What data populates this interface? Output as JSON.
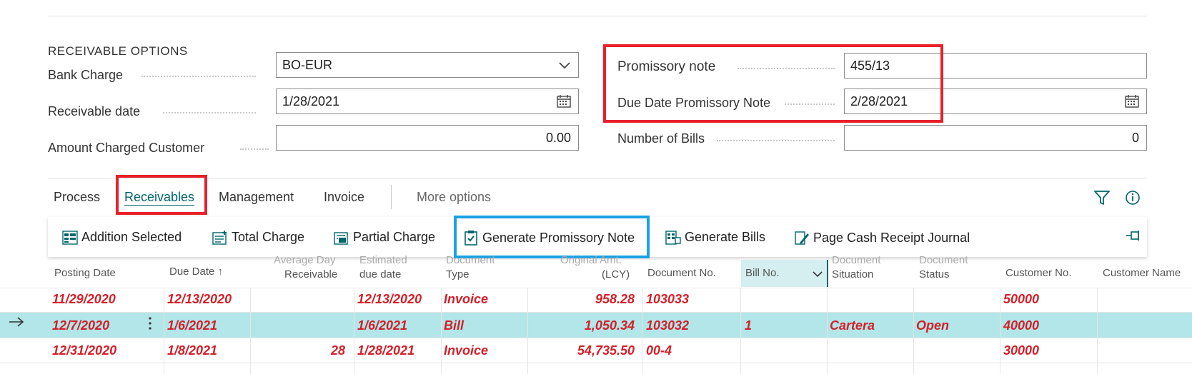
{
  "options": {
    "section_title": "RECEIVABLE OPTIONS",
    "bank_charge": {
      "label": "Bank Charge",
      "value": "BO-EUR"
    },
    "receivable_date": {
      "label": "Receivable date",
      "value": "1/28/2021"
    },
    "amount_charged": {
      "label": "Amount Charged Customer",
      "value": "0.00"
    },
    "promissory_note": {
      "label": "Promissory note",
      "value": "455/13"
    },
    "due_date_promissory": {
      "label": "Due Date Promissory Note",
      "value": "2/28/2021"
    },
    "number_of_bills": {
      "label": "Number of Bills",
      "value": "0"
    }
  },
  "tabs": {
    "process": "Process",
    "receivables": "Receivables",
    "management": "Management",
    "invoice": "Invoice",
    "more": "More options"
  },
  "actions": {
    "addition_selected": "Addition Selected",
    "total_charge": "Total Charge",
    "partial_charge": "Partial Charge",
    "generate_promissory_note": "Generate Promissory Note",
    "generate_bills": "Generate Bills",
    "page_cash_receipt_journal": "Page Cash Receipt Journal"
  },
  "columns": {
    "posting_date": "Posting Date",
    "due_date": "Due Date ↑",
    "avg_day_1": "Average Day",
    "avg_day_2": "Receivable",
    "est_due_1": "Estimated",
    "est_due_2": "due date",
    "doc_type_1": "Document",
    "doc_type_2": "Type",
    "orig_amt_1": "Original Amt.",
    "orig_amt_2": "(LCY)",
    "doc_no": "Document No.",
    "bill_no": "Bill No.",
    "doc_situation_1": "Document",
    "doc_situation_2": "Situation",
    "doc_status_1": "Document",
    "doc_status_2": "Status",
    "customer_no": "Customer No.",
    "customer_name": "Customer Name"
  },
  "rows": [
    {
      "posting_date": "11/29/2020",
      "due_date": "12/13/2020",
      "avg_day": "",
      "est_due": "12/13/2020",
      "doc_type": "Invoice",
      "amount": "958.28",
      "doc_no": "103033",
      "bill_no": "",
      "situation": "",
      "status": "",
      "customer_no": "50000"
    },
    {
      "posting_date": "12/7/2020",
      "due_date": "1/6/2021",
      "avg_day": "",
      "est_due": "1/6/2021",
      "doc_type": "Bill",
      "amount": "1,050.34",
      "doc_no": "103032",
      "bill_no": "1",
      "situation": "Cartera",
      "status": "Open",
      "customer_no": "40000"
    },
    {
      "posting_date": "12/31/2020",
      "due_date": "1/8/2021",
      "avg_day": "28",
      "est_due": "1/28/2021",
      "doc_type": "Invoice",
      "amount": "54,735.50",
      "doc_no": "00-4",
      "bill_no": "",
      "situation": "",
      "status": "",
      "customer_no": "30000"
    }
  ],
  "colors": {
    "accent": "#00656b",
    "highlight_red": "#e8202a",
    "highlight_blue": "#1ba1e2",
    "row_text": "#d3202a",
    "selected_row": "#b2e6e8"
  }
}
